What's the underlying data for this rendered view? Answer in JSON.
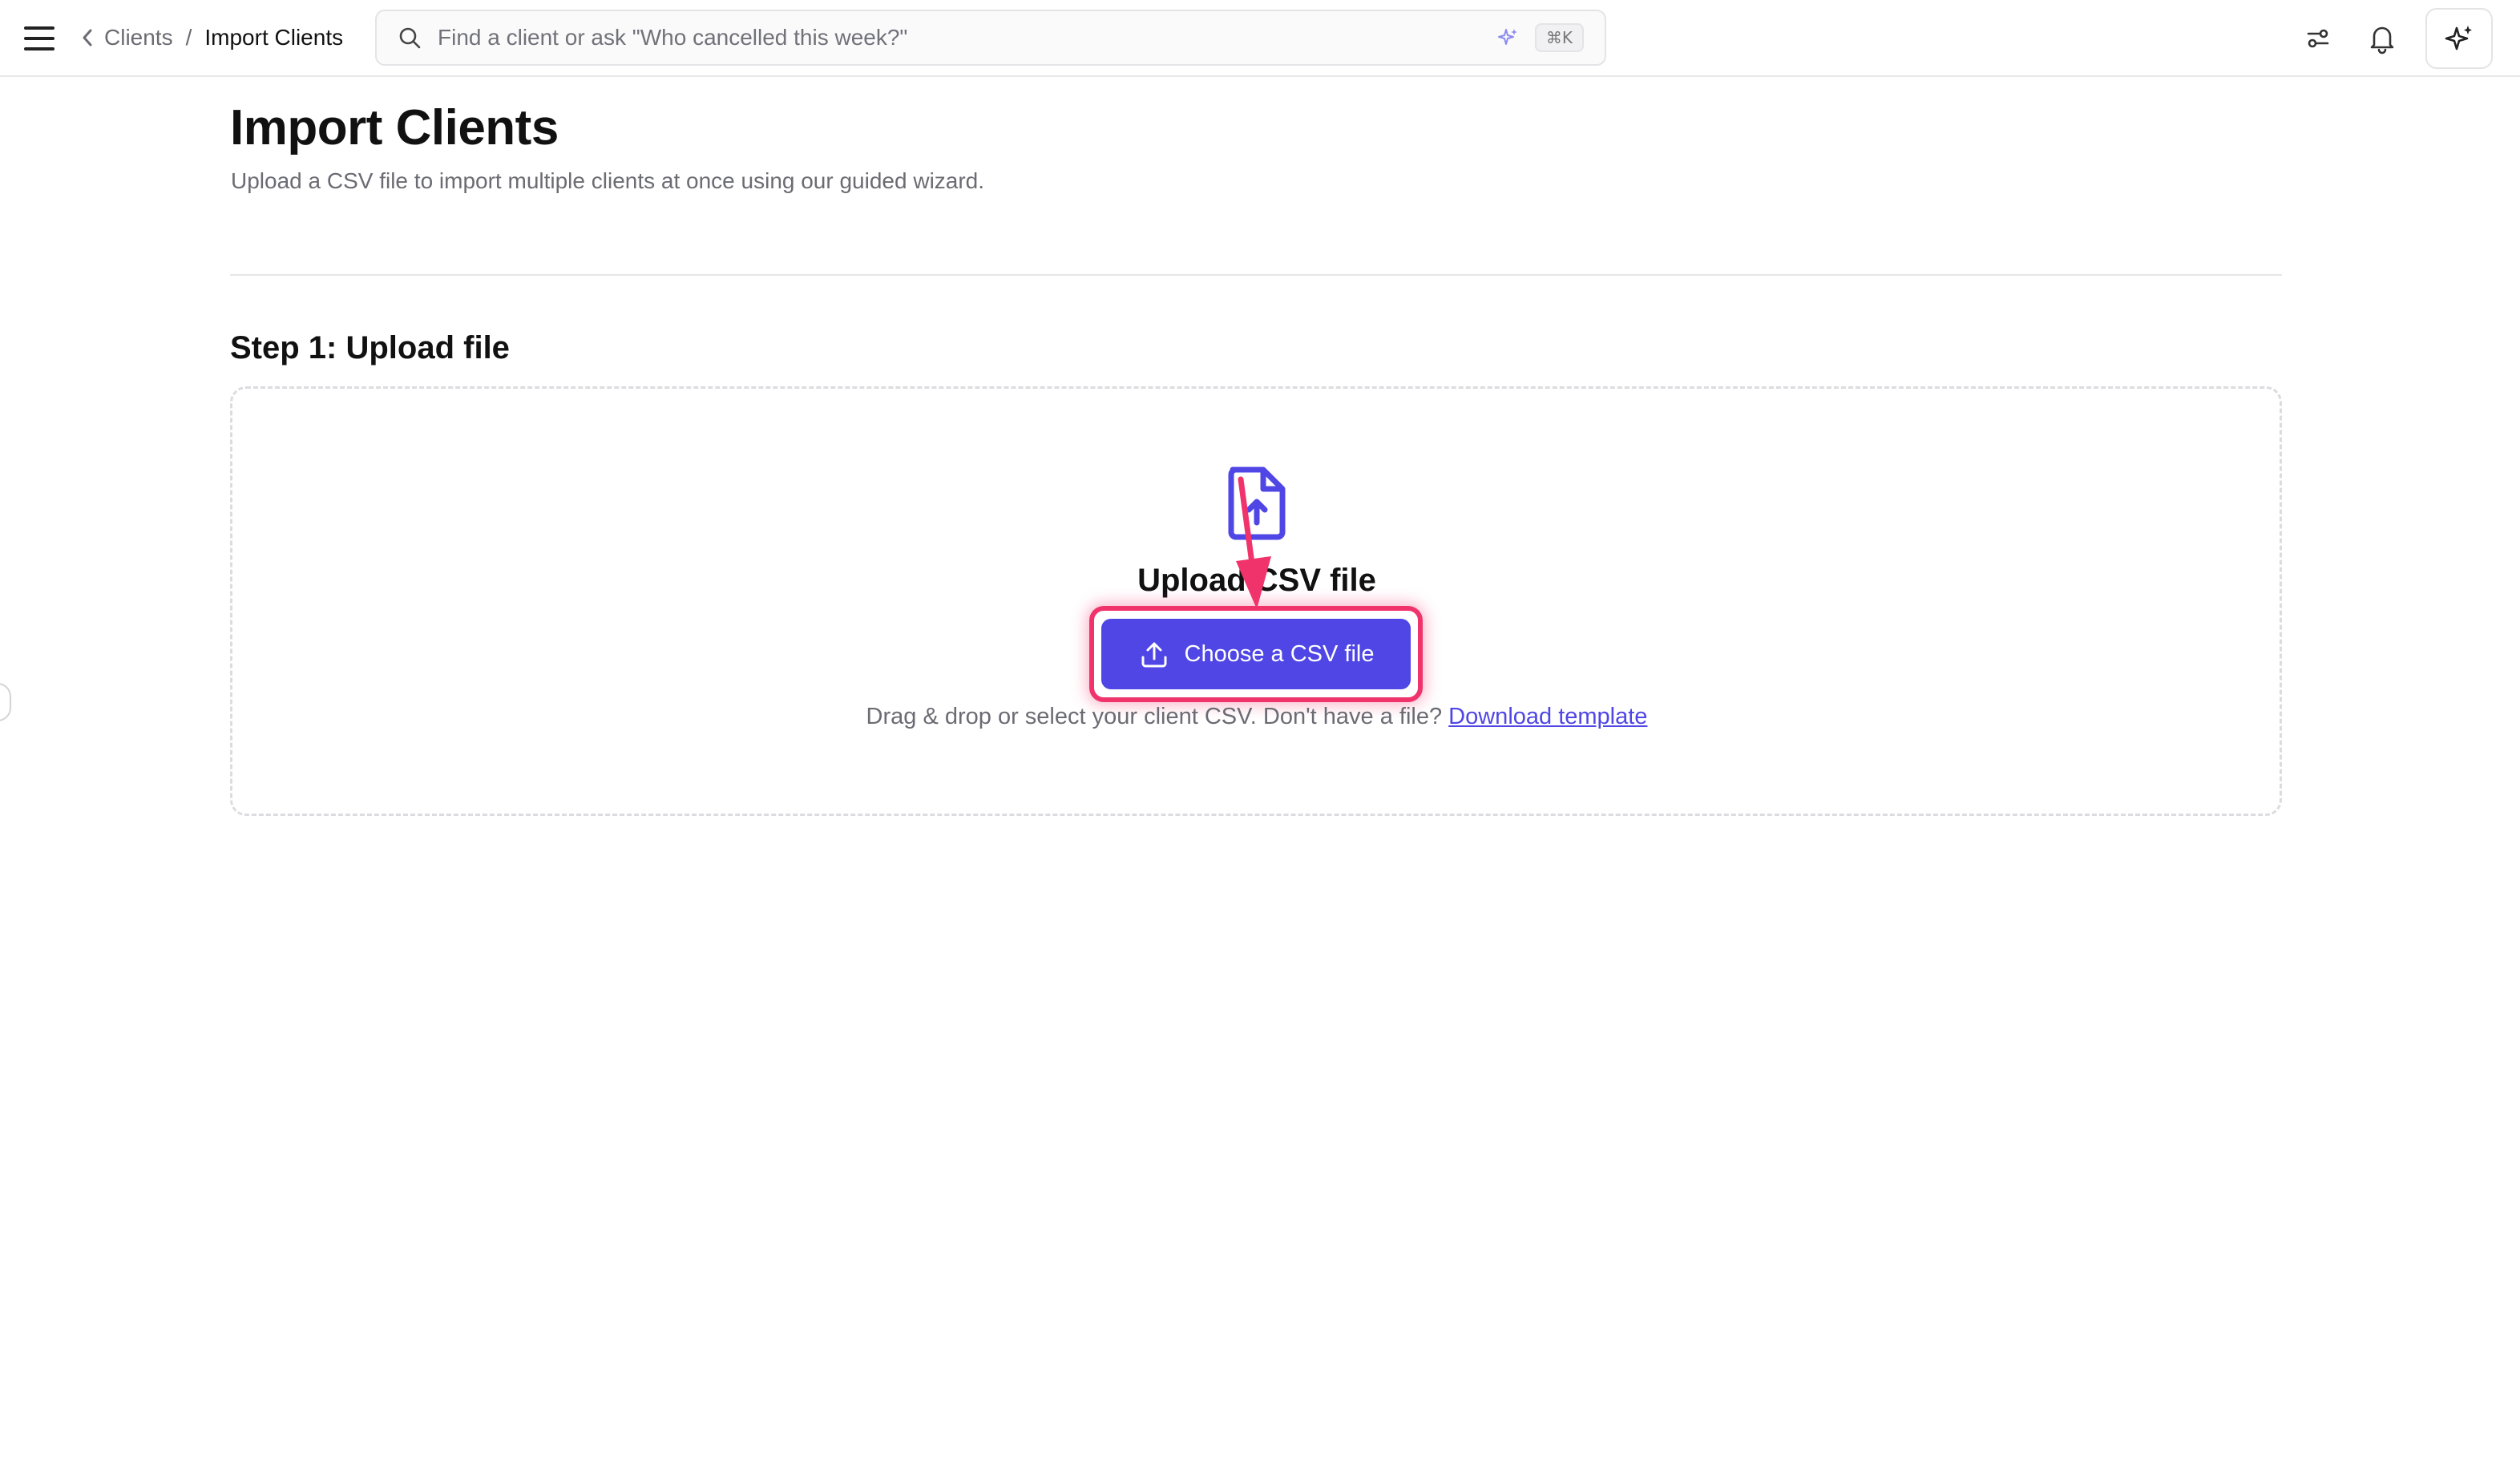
{
  "header": {
    "breadcrumb": {
      "parent": "Clients",
      "separator": "/",
      "current": "Import Clients"
    },
    "search": {
      "placeholder": "Find a client or ask \"Who cancelled this week?\"",
      "shortcut": "⌘K"
    },
    "icons": [
      "menu-icon",
      "chevron-left-icon",
      "search-icon",
      "sparkle-icon",
      "filters-icon",
      "bell-icon",
      "ai-sparkle-icon"
    ]
  },
  "page": {
    "title": "Import Clients",
    "subtitle": "Upload a CSV file to import multiple clients at once using our guided wizard."
  },
  "step": {
    "title": "Step 1: Upload file",
    "upload_heading": "Upload CSV file",
    "choose_button": "Choose a CSV file",
    "helper_text": "Drag & drop or select your client CSV. Don't have a file?",
    "download_link": "Download template"
  },
  "colors": {
    "accent": "#4f46e5",
    "highlight": "#f0336a",
    "muted_text": "#6b6b73",
    "border": "#e4e4e7"
  }
}
